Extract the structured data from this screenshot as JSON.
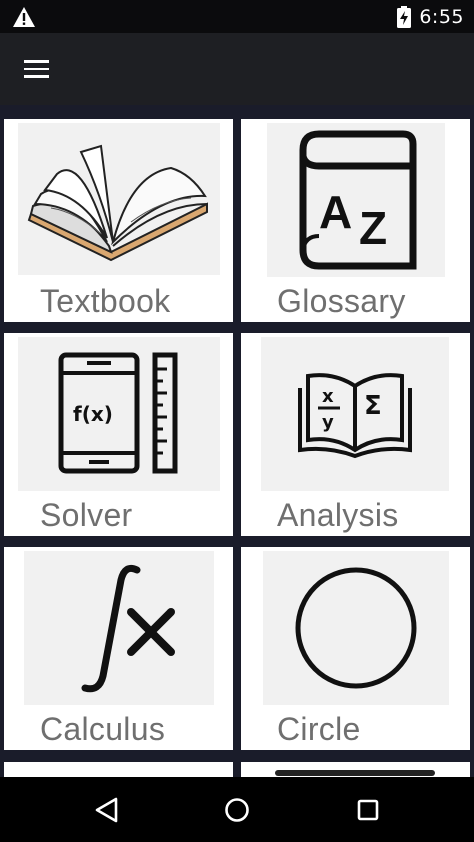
{
  "status_bar": {
    "time": "6:55",
    "warning_icon": "warning-icon",
    "battery_icon": "battery-charging-icon"
  },
  "app_bar": {
    "menu_icon": "hamburger-menu-icon"
  },
  "tiles": [
    {
      "label": "Textbook",
      "icon": "open-book-icon"
    },
    {
      "label": "Glossary",
      "icon": "dictionary-az-icon"
    },
    {
      "label": "Solver",
      "icon": "calculator-phone-icon"
    },
    {
      "label": "Analysis",
      "icon": "formula-book-icon"
    },
    {
      "label": "Calculus",
      "icon": "integral-icon"
    },
    {
      "label": "Circle",
      "icon": "circle-icon"
    }
  ],
  "nav_bar": {
    "back_icon": "back-triangle-icon",
    "home_icon": "home-circle-icon",
    "recents_icon": "recents-square-icon"
  },
  "colors": {
    "status_bar": "#0b0b0d",
    "app_bar": "#1e1f23",
    "content_bg": "#1a1c2a",
    "tile_bg": "#ffffff",
    "label": "#6f6f6f"
  }
}
